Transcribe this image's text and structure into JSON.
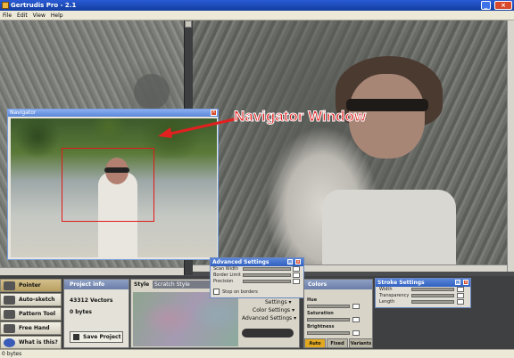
{
  "window": {
    "title": "Gertrudis Pro - 2.1"
  },
  "menu": [
    "File",
    "Edit",
    "View",
    "Help"
  ],
  "navigator": {
    "title": "Navigator"
  },
  "annotation": {
    "text": "Navigator Window",
    "color": "#e32020"
  },
  "tools": [
    {
      "label": "Pointer",
      "active": true
    },
    {
      "label": "Auto-sketch Too"
    },
    {
      "label": "Pattern Tool"
    },
    {
      "label": "Free Hand"
    },
    {
      "label": "What is this?"
    }
  ],
  "project_info": {
    "title": "Project info",
    "vectors": "43312 Vectors",
    "bytes": "0 bytes",
    "save_label": "Save Project"
  },
  "style": {
    "label": "Style",
    "selected": "Scratch Style",
    "settings": "Settings",
    "color_settings": "Color Settings",
    "advanced_settings": "Advanced Settings"
  },
  "advanced_window": {
    "title": "Advanced Settings",
    "rows": [
      "Scan Width",
      "Border Limit",
      "Precision"
    ],
    "stop_on_borders": "Stop on borders"
  },
  "colors": {
    "title": "Colors",
    "rows": [
      "Hue",
      "Saturation",
      "Brightness"
    ],
    "tabs": [
      "Auto",
      "Fixed",
      "Variants"
    ],
    "active_tab": "Auto"
  },
  "stroke_window": {
    "title": "Stroke Settings",
    "rows": [
      "Width",
      "Transparency",
      "Length"
    ]
  },
  "status": {
    "text": "0 bytes"
  }
}
